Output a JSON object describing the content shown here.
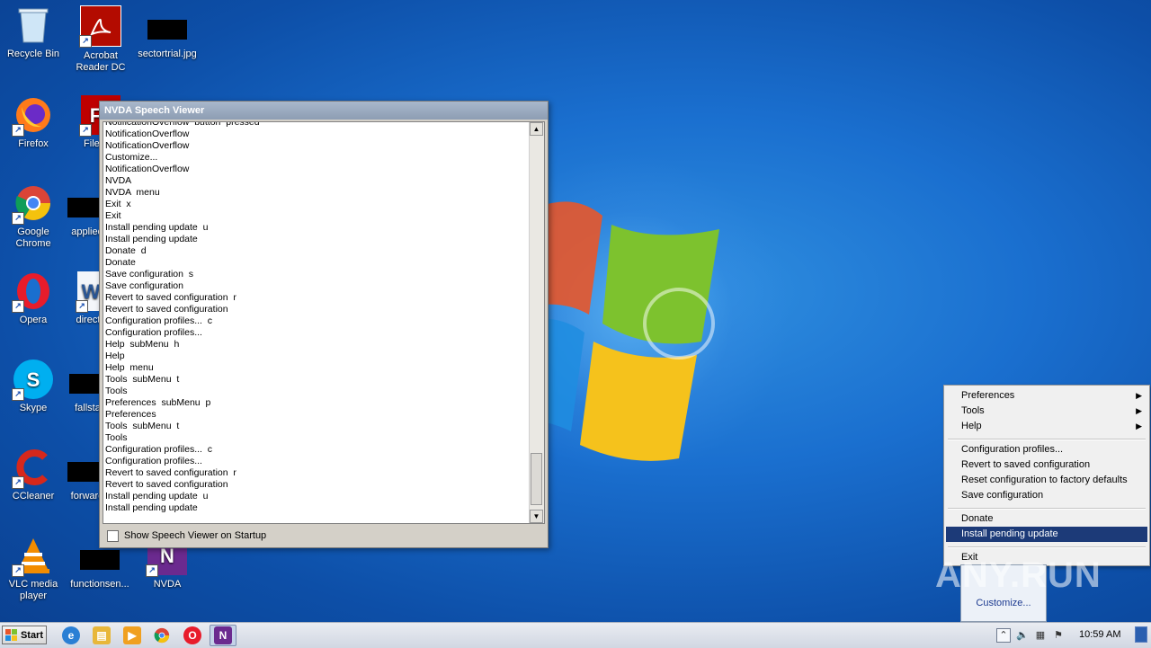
{
  "desktop": {
    "icons": [
      {
        "label": "Recycle Bin",
        "icon": "recycle-bin-icon"
      },
      {
        "label": "Acrobat Reader DC",
        "icon": "acrobat-icon"
      },
      {
        "label": "sectortrial.jpg",
        "icon": "image-file-icon"
      },
      {
        "label": "Firefox",
        "icon": "firefox-icon"
      },
      {
        "label": "FileZilla",
        "icon": "filezilla-icon"
      },
      {
        "label": "Google Chrome",
        "icon": "chrome-icon"
      },
      {
        "label": "applied",
        "icon": "file-icon"
      },
      {
        "label": "Opera",
        "icon": "opera-icon"
      },
      {
        "label": "directa",
        "icon": "word-document-icon"
      },
      {
        "label": "Skype",
        "icon": "skype-icon"
      },
      {
        "label": "fallstat",
        "icon": "file-icon"
      },
      {
        "label": "CCleaner",
        "icon": "ccleaner-icon"
      },
      {
        "label": "forward",
        "icon": "file-icon"
      },
      {
        "label": "VLC media player",
        "icon": "vlc-icon"
      },
      {
        "label": "functionsen...",
        "icon": "file-icon"
      },
      {
        "label": "NVDA",
        "icon": "nvda-icon"
      }
    ]
  },
  "speech_viewer": {
    "title": "NVDA Speech Viewer",
    "lines": [
      "NotificationOverflow  button  pressed",
      "NotificationOverflow",
      "NotificationOverflow",
      "Customize...",
      "NotificationOverflow",
      "NVDA",
      "NVDA  menu",
      "Exit  x",
      "Exit",
      "Install pending update  u",
      "Install pending update",
      "Donate  d",
      "Donate",
      "Save configuration  s",
      "Save configuration",
      "Revert to saved configuration  r",
      "Revert to saved configuration",
      "Configuration profiles...  c",
      "Configuration profiles...",
      "Help  subMenu  h",
      "Help",
      "Help  menu",
      "Tools  subMenu  t",
      "Tools",
      "Preferences  subMenu  p",
      "Preferences",
      "Tools  subMenu  t",
      "Tools",
      "Configuration profiles...  c",
      "Configuration profiles...",
      "Revert to saved configuration  r",
      "Revert to saved configuration",
      "Install pending update  u",
      "Install pending update"
    ],
    "startup_checkbox_label": "Show Speech Viewer on Startup",
    "startup_checked": false
  },
  "context_menu": {
    "items": [
      {
        "label": "Preferences",
        "submenu": true
      },
      {
        "label": "Tools",
        "submenu": true
      },
      {
        "label": "Help",
        "submenu": true
      },
      {
        "label": "Configuration profiles..."
      },
      {
        "label": "Revert to saved configuration"
      },
      {
        "label": "Reset configuration to factory defaults"
      },
      {
        "label": "Save configuration"
      },
      {
        "label": "Donate"
      },
      {
        "label": "Install pending update",
        "highlighted": true
      },
      {
        "label": "Exit"
      }
    ],
    "submenu_arrow": "▶"
  },
  "tray_popup": {
    "link": "Customize..."
  },
  "watermark": "ANY.RUN",
  "taskbar": {
    "start_label": "Start",
    "clock": "10:59 AM",
    "pinned": [
      "ie-icon",
      "explorer-icon",
      "media-player-icon",
      "chrome-icon",
      "opera-icon",
      "nvda-icon"
    ]
  },
  "colors": {
    "desktop_blue": "#1a6fcf",
    "menu_highlight": "#1c3a78",
    "title_bar": "#8d9db3"
  }
}
